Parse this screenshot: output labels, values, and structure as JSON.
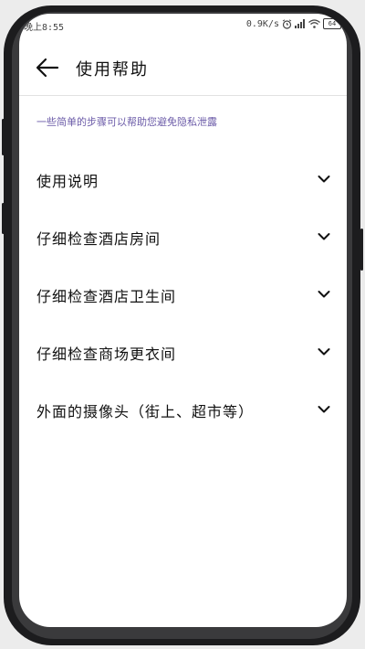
{
  "status_bar": {
    "time": "晚上8:55",
    "net_speed": "0.9K/s",
    "battery": "64",
    "icons": [
      "alarm-icon",
      "signal-icon",
      "wifi-icon",
      "battery-icon"
    ]
  },
  "header": {
    "back_icon": "arrow-left-icon",
    "title": "使用帮助"
  },
  "hint": "一些简单的步骤可以帮助您避免隐私泄露",
  "items": [
    {
      "label": "使用说明",
      "icon": "chevron-down-icon"
    },
    {
      "label": "仔细检查酒店房间",
      "icon": "chevron-down-icon"
    },
    {
      "label": "仔细检查酒店卫生间",
      "icon": "chevron-down-icon"
    },
    {
      "label": "仔细检查商场更衣间",
      "icon": "chevron-down-icon"
    },
    {
      "label": "外面的摄像头（街上、超市等）",
      "icon": "chevron-down-icon"
    }
  ],
  "colors": {
    "hint": "#6b5ba8",
    "frame": "#1c1c1e",
    "background": "#ffffff"
  }
}
